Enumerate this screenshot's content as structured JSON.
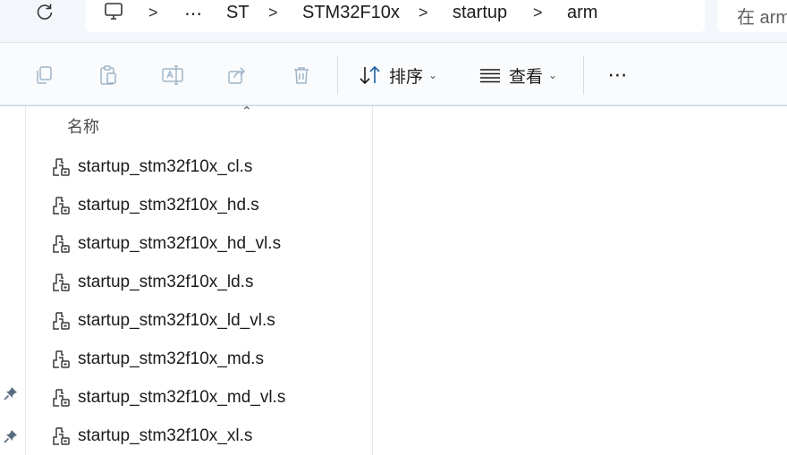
{
  "breadcrumb": {
    "items": [
      "⋯",
      "ST",
      "STM32F10x",
      "startup",
      "arm"
    ]
  },
  "search": {
    "placeholder": "在 arm"
  },
  "toolbar": {
    "sort_label": "排序",
    "view_label": "查看",
    "more_label": "⋯"
  },
  "file_list": {
    "column_name": "名称",
    "files": [
      "startup_stm32f10x_cl.s",
      "startup_stm32f10x_hd.s",
      "startup_stm32f10x_hd_vl.s",
      "startup_stm32f10x_ld.s",
      "startup_stm32f10x_ld_vl.s",
      "startup_stm32f10x_md.s",
      "startup_stm32f10x_md_vl.s",
      "startup_stm32f10x_xl.s"
    ]
  },
  "colors": {
    "accent": "#0067c0",
    "toolbar_bg": "#f9fbfd",
    "address_bg": "#f3f6fb"
  },
  "icons": {
    "refresh": "refresh-icon",
    "computer": "computer-icon",
    "copy": "copy-icon",
    "paste": "paste-icon",
    "rename": "rename-icon",
    "share": "share-icon",
    "delete": "delete-icon",
    "sort": "sort-icon",
    "view": "view-icon",
    "pin": "pin-icon",
    "file": "asm-file-icon"
  }
}
